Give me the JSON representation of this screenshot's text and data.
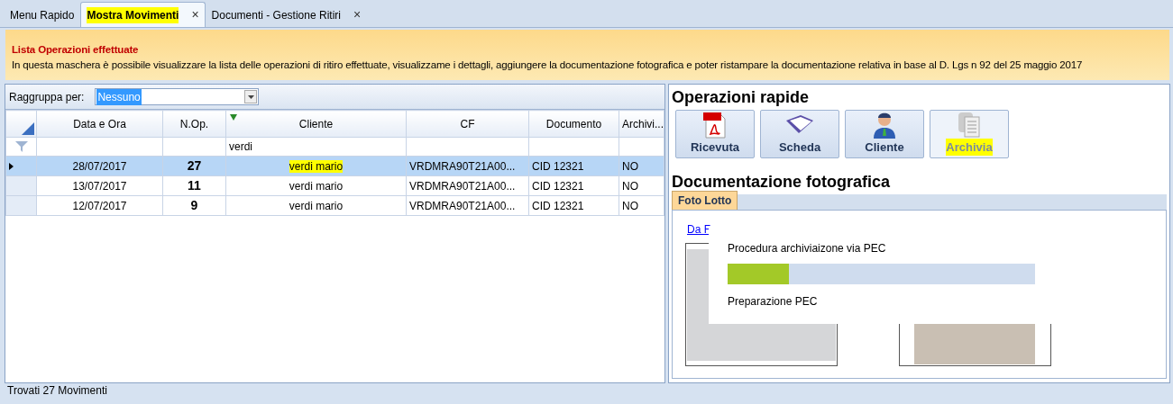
{
  "tabs": [
    {
      "label": "Menu Rapido",
      "selected": false,
      "closable": false,
      "highlighted": false
    },
    {
      "label": "Mostra Movimenti",
      "selected": true,
      "closable": true,
      "highlighted": true
    },
    {
      "label": "Documenti - Gestione Ritiri",
      "selected": false,
      "closable": true,
      "highlighted": false
    }
  ],
  "close_glyph": "×",
  "info_banner": {
    "title": "Lista Operazioni effettuate",
    "text": "In questa maschera è possibile visualizzare la lista delle operazioni di ritiro effettuate, visualizzame i dettagli, aggiungere la documentazione fotografica e poter ristampare la documentazione relativa in base al D. Lgs n 92 del 25 maggio 2017"
  },
  "group_by": {
    "label": "Raggruppa per:",
    "value": "Nessuno"
  },
  "table": {
    "columns": [
      {
        "label": "Data e Ora",
        "filtered": false
      },
      {
        "label": "N.Op.",
        "filtered": false
      },
      {
        "label": "Cliente",
        "filtered": true,
        "filter_text": "verdi"
      },
      {
        "label": "CF",
        "filtered": false
      },
      {
        "label": "Documento",
        "filtered": false
      },
      {
        "label": "Archivi...",
        "filtered": false
      }
    ],
    "rows": [
      {
        "selected": true,
        "cells": [
          "28/07/2017",
          "27",
          "verdi mario",
          "VRDMRA90T21A00...",
          "CID 12321",
          "NO"
        ],
        "client_highlighted": true
      },
      {
        "selected": false,
        "cells": [
          "13/07/2017",
          "11",
          "verdi mario",
          "VRDMRA90T21A00...",
          "CID 12321",
          "NO"
        ],
        "client_highlighted": false
      },
      {
        "selected": false,
        "cells": [
          "12/07/2017",
          "9",
          "verdi mario",
          "VRDMRA90T21A00...",
          "CID 12321",
          "NO"
        ],
        "client_highlighted": false
      }
    ]
  },
  "quick_ops": {
    "title": "Operazioni rapide",
    "buttons": [
      {
        "label": "Ricevuta",
        "kind": "pdf",
        "disabled": false,
        "highlighted": false
      },
      {
        "label": "Scheda",
        "kind": "book",
        "disabled": false,
        "highlighted": false
      },
      {
        "label": "Cliente",
        "kind": "person",
        "disabled": false,
        "highlighted": false
      },
      {
        "label": "Archivia",
        "kind": "documents",
        "disabled": true,
        "highlighted": true
      }
    ]
  },
  "photo_docs": {
    "title": "Documentazione fotografica",
    "tabs": [
      {
        "label": "Foto Lotto",
        "selected": true
      }
    ],
    "link": "Da F"
  },
  "progress_popup": {
    "title": "Procedura archiviaizone via PEC",
    "level": 0.2,
    "status": "Preparazione PEC"
  },
  "status_bar": "Trovati 27 Movimenti"
}
